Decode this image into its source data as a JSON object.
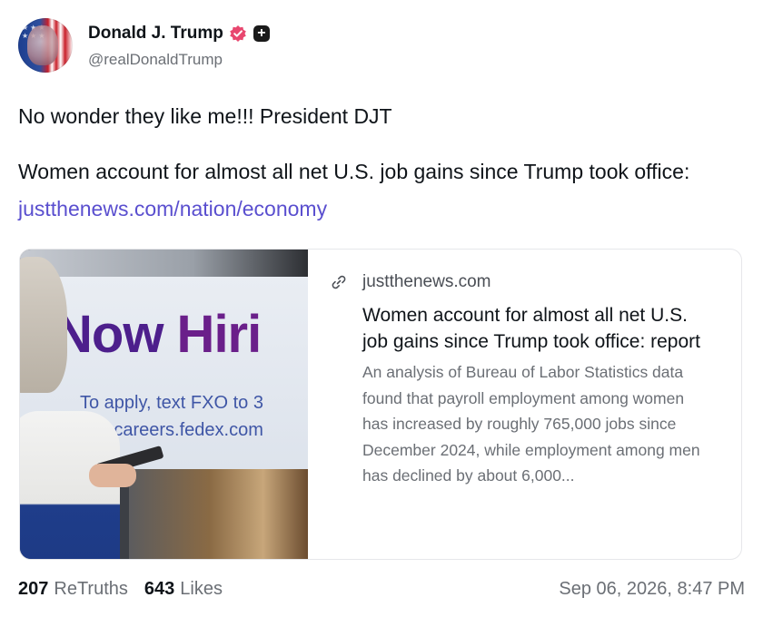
{
  "author": {
    "display_name": "Donald J. Trump",
    "handle": "@realDonaldTrump",
    "avatar_icon": "avatar-flag-portrait",
    "verified_icon": "verified-badge-icon",
    "verified_color": "#e8476f",
    "plus_badge": "+"
  },
  "post": {
    "line1": "No wonder they like me!!! President DJT",
    "line2": "Women account for almost all net U.S. job gains since Trump took office: ",
    "link_text": "justthenews.com/nation/economy",
    "link_color": "#5a4fcf"
  },
  "card": {
    "domain": "justthenews.com",
    "domain_icon": "link-icon",
    "title": "Women account for almost all net U.S. job gains since Trump took office: report",
    "description": "An analysis of Bureau of Labor Statistics data found that payroll employment among women has increased by roughly 765,000 jobs since December 2024, while employment among men has declined by about 6,000...",
    "image": {
      "sign_now": "Now",
      "sign_hiri": " Hiri",
      "sign_apply": "To apply, text FXO to 3",
      "sign_careers": "or visit careers.fedex.com"
    }
  },
  "footer": {
    "retruths_count": "207",
    "retruths_label": "ReTruths",
    "likes_count": "643",
    "likes_label": "Likes",
    "timestamp": "Sep 06, 2026, 8:47 PM"
  }
}
